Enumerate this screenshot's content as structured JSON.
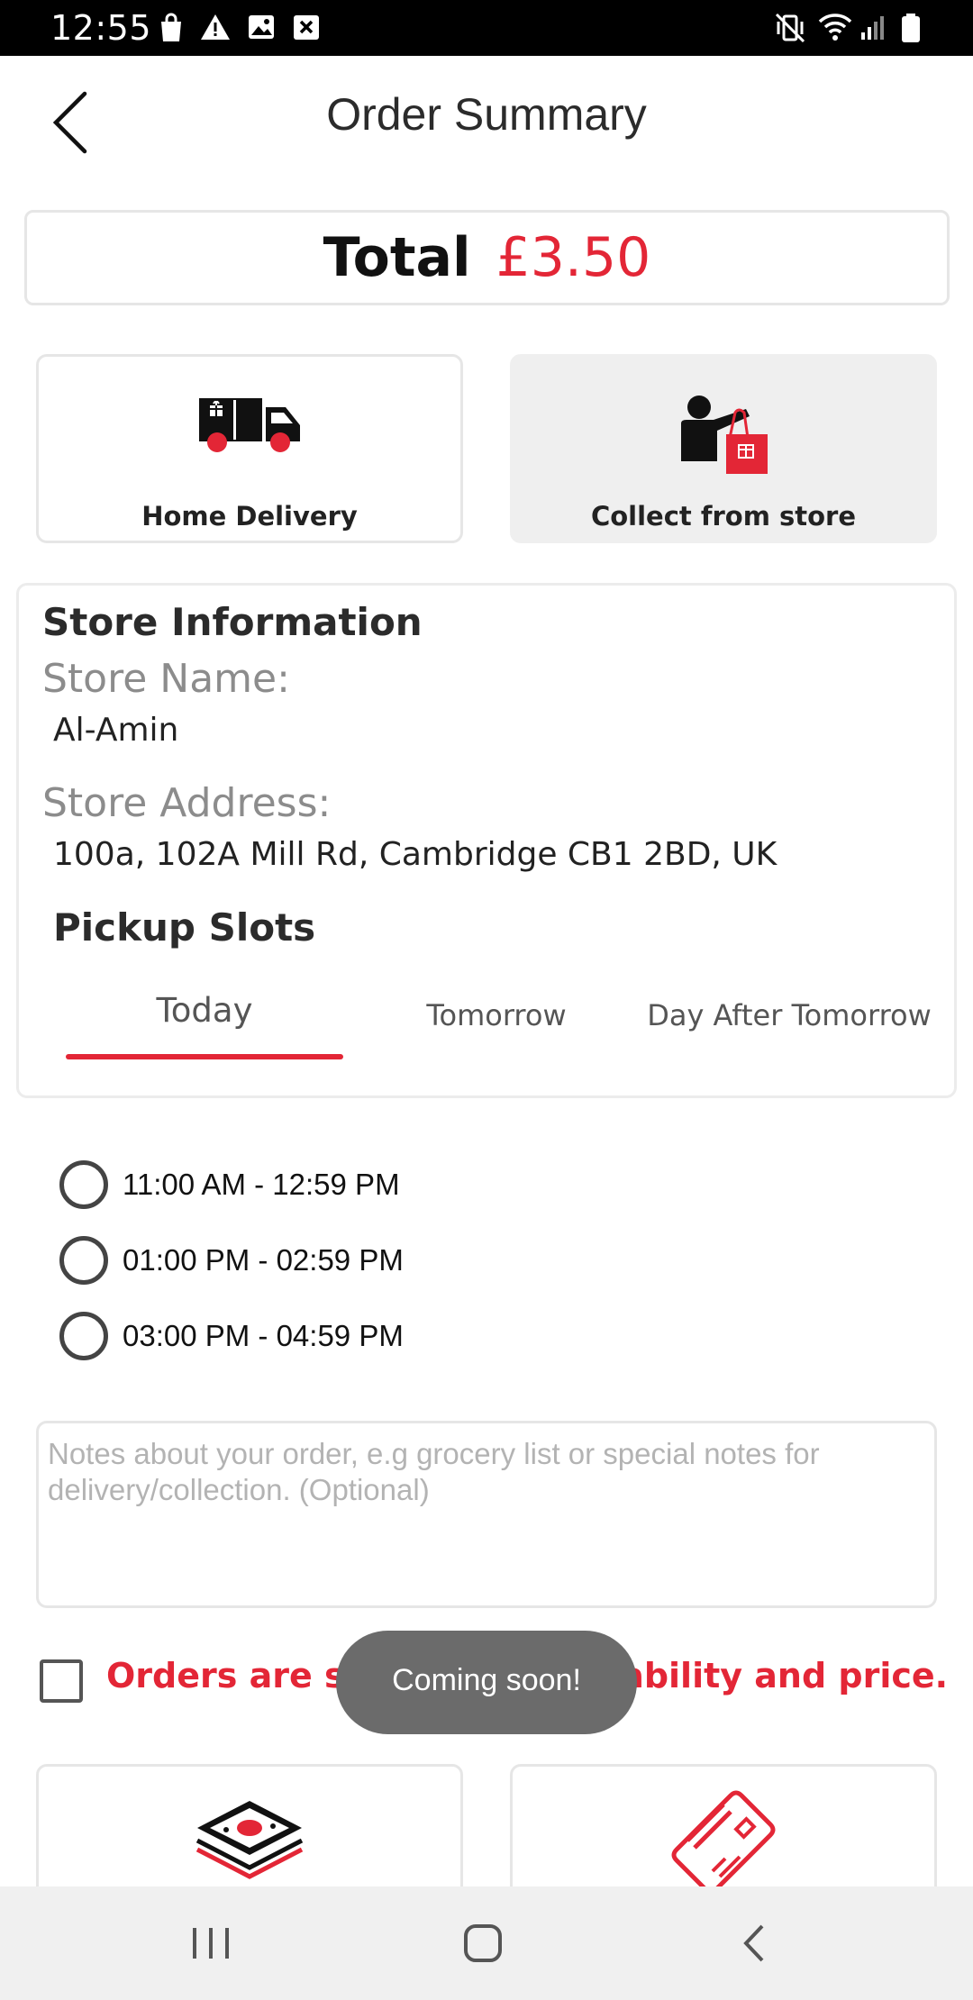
{
  "status_bar": {
    "time": "12:55",
    "left_icons": [
      "shopping-bag-icon",
      "warning-icon",
      "image-icon",
      "close-box-icon"
    ],
    "right_icons": [
      "mute-vibrate-icon",
      "wifi-icon",
      "signal-icon",
      "battery-icon"
    ]
  },
  "header": {
    "title": "Order Summary",
    "back_icon": "chevron-left-icon"
  },
  "total": {
    "label": "Total",
    "amount": "£3.50"
  },
  "delivery_options": [
    {
      "label": "Home Delivery",
      "icon": "delivery-van-icon",
      "selected": false
    },
    {
      "label": "Collect from store",
      "icon": "person-with-bag-icon",
      "selected": true
    }
  ],
  "store": {
    "heading": "Store Information",
    "name_label": "Store Name:",
    "name": "Al-Amin",
    "address_label": "Store Address:",
    "address": "100a, 102A Mill Rd, Cambridge CB1 2BD, UK"
  },
  "pickup": {
    "heading": "Pickup Slots",
    "tabs": [
      {
        "label": "Today",
        "active": true
      },
      {
        "label": "Tomorrow",
        "active": false
      },
      {
        "label": "Day After Tomorrow",
        "active": false
      }
    ],
    "slots": [
      {
        "label": "11:00 AM - 12:59 PM",
        "checked": false
      },
      {
        "label": "01:00 PM - 02:59 PM",
        "checked": false
      },
      {
        "label": "03:00 PM - 04:59 PM",
        "checked": false
      }
    ]
  },
  "notes": {
    "placeholder": "Notes about your order, e.g grocery list or special notes for delivery/collection. (Optional)",
    "value": ""
  },
  "terms": {
    "text": "Orders are subject to availability and price.",
    "checked": false
  },
  "toast": {
    "text": "Coming soon!"
  },
  "payment_options": [
    {
      "icon": "cash-icon"
    },
    {
      "icon": "credit-card-icon"
    }
  ],
  "colors": {
    "accent": "#e32636",
    "selected_bg": "#efefef",
    "toast_bg": "#6b6b6b"
  },
  "nav_bar": {
    "icons": [
      "recent-apps-icon",
      "home-icon",
      "back-icon"
    ]
  }
}
